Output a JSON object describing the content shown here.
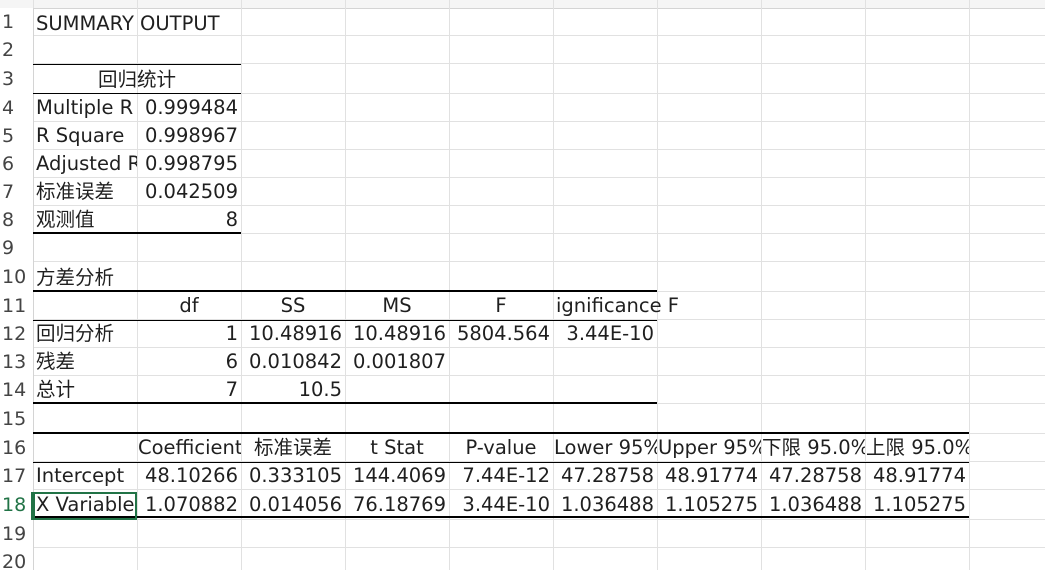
{
  "row_numbers": [
    "1",
    "2",
    "3",
    "4",
    "5",
    "6",
    "7",
    "8",
    "9",
    "10",
    "11",
    "12",
    "13",
    "14",
    "15",
    "16",
    "17",
    "18",
    "19",
    "20"
  ],
  "active_row": "18",
  "summary_title": "SUMMARY OUTPUT",
  "regression_stats": {
    "header": "回归统计",
    "rows": [
      {
        "label": "Multiple R",
        "value": "0.999484"
      },
      {
        "label": "R Square",
        "value": "0.998967"
      },
      {
        "label": "Adjusted R",
        "value": "0.998795"
      },
      {
        "label": "标准误差",
        "value": "0.042509"
      },
      {
        "label": "观测值",
        "value": "8"
      }
    ]
  },
  "anova": {
    "title": "方差分析",
    "headers": [
      "",
      "df",
      "SS",
      "MS",
      "F",
      "ignificance F"
    ],
    "rows": [
      [
        "回归分析",
        "1",
        "10.48916",
        "10.48916",
        "5804.564",
        "3.44E-10"
      ],
      [
        "残差",
        "6",
        "0.010842",
        "0.001807",
        "",
        ""
      ],
      [
        "总计",
        "7",
        "10.5",
        "",
        "",
        ""
      ]
    ]
  },
  "coefficients": {
    "headers": [
      "",
      "Coefficients",
      "标准误差",
      "t Stat",
      "P-value",
      "Lower 95%",
      "Upper 95%",
      "下限 95.0%",
      "上限 95.0%"
    ],
    "rows": [
      [
        "Intercept",
        "48.10266",
        "0.333105",
        "144.4069",
        "7.44E-12",
        "47.28758",
        "48.91774",
        "47.28758",
        "48.91774"
      ],
      [
        "X Variable",
        "1.070882",
        "0.014056",
        "76.18769",
        "3.44E-10",
        "1.036488",
        "1.105275",
        "1.036488",
        "1.105275"
      ]
    ]
  },
  "colors": {
    "grid": "#e1e1e1",
    "selection": "#217346",
    "text": "#1f1f1f"
  }
}
